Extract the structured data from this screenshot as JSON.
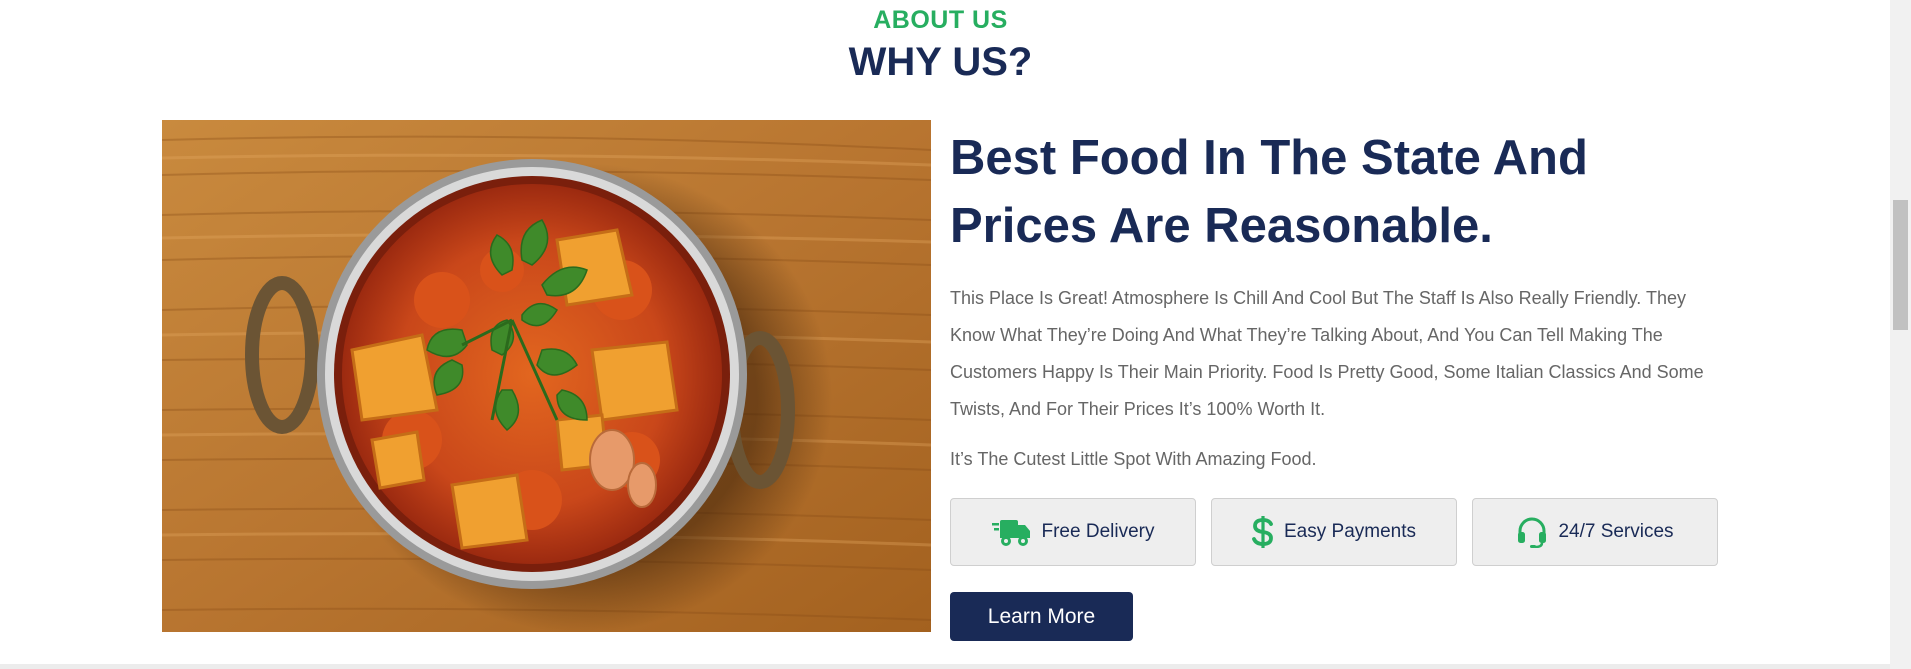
{
  "section": {
    "subtitle": "ABOUT US",
    "title": "WHY US?"
  },
  "about": {
    "headline_line1": "Best Food In The State And",
    "headline_line2": "Prices Are Reasonable.",
    "paragraph1": "This Place Is Great! Atmosphere Is Chill And Cool But The Staff Is Also Really Friendly. They Know What They’re Doing And What They’re Talking About, And You Can Tell Making The Customers Happy Is Their Main Priority. Food Is Pretty Good, Some Italian Classics And Some Twists, And For Their Prices It’s 100% Worth It.",
    "paragraph2": "It’s The Cutest Little Spot With Amazing Food."
  },
  "features": [
    {
      "label": "Free Delivery",
      "icon": "truck-icon"
    },
    {
      "label": "Easy Payments",
      "icon": "dollar-icon"
    },
    {
      "label": "24/7 Services",
      "icon": "headset-icon"
    }
  ],
  "cta": {
    "learn_more": "Learn More"
  },
  "colors": {
    "accent_green": "#27ae60",
    "navy": "#192a56",
    "text_gray": "#666666"
  }
}
